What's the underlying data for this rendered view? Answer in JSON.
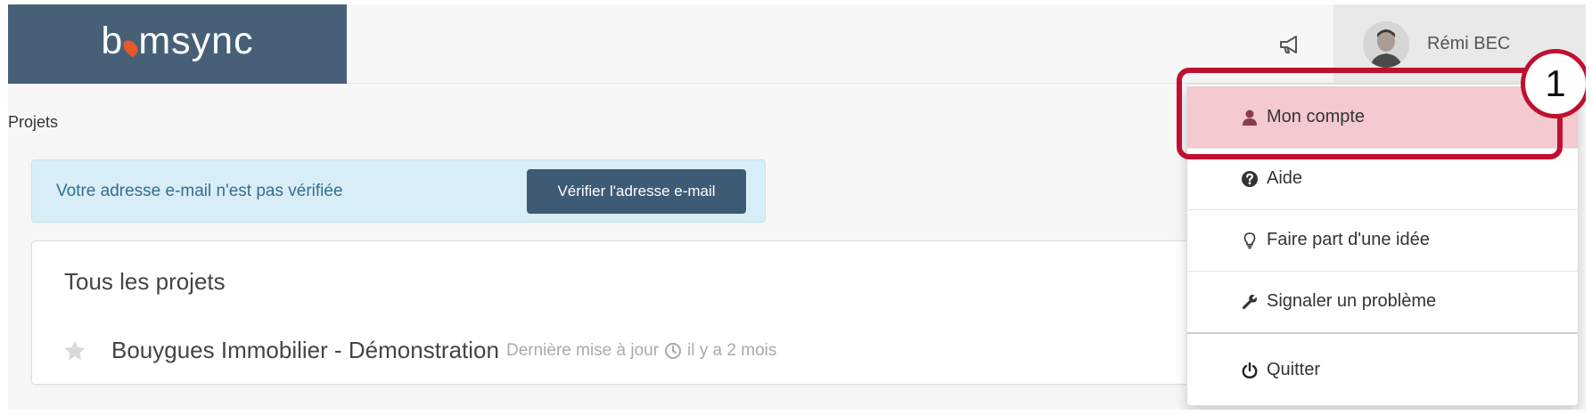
{
  "header": {
    "logo_text_before": "b",
    "logo_text_after": "msync",
    "user_name": "Rémi BEC",
    "icons": {
      "announcements": "bullhorn-icon",
      "avatar": "user-avatar"
    }
  },
  "breadcrumb": "Projets",
  "alert": {
    "message": "Votre adresse e-mail n'est pas vérifiée",
    "button_label": "Vérifier l'adresse e-mail"
  },
  "projects_panel": {
    "title": "Tous les projets",
    "projects": [
      {
        "name": "Bouygues Immobilier - Démonstration",
        "updated_prefix": "Dernière mise à jour",
        "updated_relative": "il y a 2 mois"
      }
    ]
  },
  "user_dropdown": {
    "items": [
      {
        "label": "Mon compte",
        "icon": "user-icon"
      },
      {
        "label": "Aide",
        "icon": "question-circle-icon"
      },
      {
        "label": "Faire part d'une idée",
        "icon": "lightbulb-icon"
      },
      {
        "label": "Signaler un problème",
        "icon": "wrench-icon"
      },
      {
        "label": "Quitter",
        "icon": "power-icon"
      }
    ]
  },
  "annotation": {
    "step_number": "1"
  },
  "colors": {
    "brand_header": "#476078",
    "logo_accent": "#e8582b",
    "primary_button": "#3e5b76",
    "alert_bg": "#d9edf7",
    "alert_text": "#31708f",
    "highlight_fill": "#f4c9d0",
    "annotation_red": "#c0102f"
  }
}
